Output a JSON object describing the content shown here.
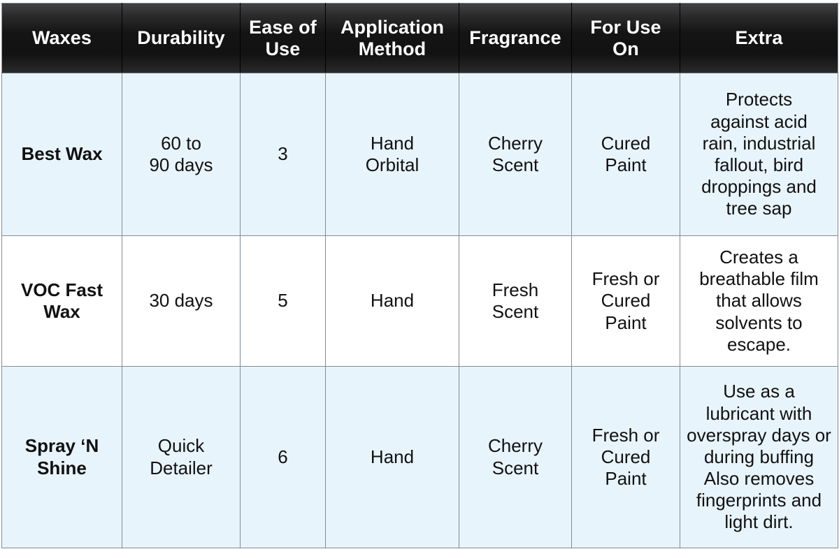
{
  "table": {
    "columns": [
      {
        "key": "waxes",
        "label": "Waxes"
      },
      {
        "key": "durability",
        "label": "Durability"
      },
      {
        "key": "ease",
        "label": "Ease of\nUse"
      },
      {
        "key": "method",
        "label": "Application\nMethod"
      },
      {
        "key": "fragrance",
        "label": "Fragrance"
      },
      {
        "key": "foruse",
        "label": "For Use\nOn"
      },
      {
        "key": "extra",
        "label": "Extra"
      }
    ],
    "rows": [
      {
        "waxes": "Best Wax",
        "durability": "60 to\n90 days",
        "ease": "3",
        "method": "Hand\nOrbital",
        "fragrance": "Cherry\nScent",
        "foruse": "Cured\nPaint",
        "extra": "Protects\nagainst acid\nrain, industrial\nfallout, bird\ndroppings and\ntree sap"
      },
      {
        "waxes": "VOC Fast\nWax",
        "durability": "30 days",
        "ease": "5",
        "method": "Hand",
        "fragrance": "Fresh\nScent",
        "foruse": "Fresh or\nCured\nPaint",
        "extra": "Creates a\nbreathable film\nthat allows\nsolvents to\nescape."
      },
      {
        "waxes": "Spray ‘N\nShine",
        "durability": "Quick\nDetailer",
        "ease": "6",
        "method": "Hand",
        "fragrance": "Cherry\nScent",
        "foruse": "Fresh or\nCured\nPaint",
        "extra": "Use as a\nlubricant with\noverspray days or\nduring buffing\nAlso removes\nfingerprints and\nlight dirt."
      }
    ]
  },
  "colors": {
    "header_background": "#141414",
    "header_text": "#ffffff",
    "row_tint": "#e8f4fb",
    "row_plain": "#ffffff",
    "border": "#7f8d97",
    "body_text": "#111111"
  }
}
